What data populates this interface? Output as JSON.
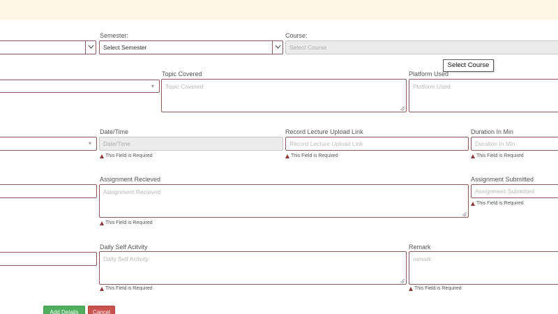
{
  "form": {
    "semester": {
      "label": "Semester:",
      "value": "Select Semester"
    },
    "course": {
      "label": "Course:",
      "placeholder": "Select Course",
      "tooltip": "Select Course"
    },
    "topic_covered": {
      "label": "Topic Covered",
      "placeholder": "Topic Covered"
    },
    "platform_used": {
      "label": "Platform Used",
      "placeholder": "Platform Used"
    },
    "date_time": {
      "label": "Date/Time",
      "placeholder": "Date/Time"
    },
    "record_lecture": {
      "label": "Record Lecture Upload Link",
      "placeholder": "Record Lecture Upload Link"
    },
    "duration": {
      "label": "Duration In Min",
      "placeholder": "Duration In Min"
    },
    "assignment_received": {
      "label": "Assignment Recieved",
      "placeholder": "Assignment Recieved"
    },
    "assignment_submitted": {
      "label": "Assignment Submitted",
      "placeholder": "Assignment Submitted"
    },
    "daily_self_activity": {
      "label": "Daily Self Acitvity",
      "placeholder": "Daily Self Acitvity"
    },
    "remark": {
      "label": "Remark",
      "placeholder": "remark"
    },
    "validation_message": "This Field is Required"
  },
  "buttons": {
    "add": "Add Details",
    "cancel": "Cancel"
  },
  "colors": {
    "top_banner": "#fdf6e3",
    "field_border": "#8c5a5a",
    "error_icon": "#8b3a3a",
    "add_button": "#4fae5d",
    "cancel_button": "#c9524d"
  }
}
